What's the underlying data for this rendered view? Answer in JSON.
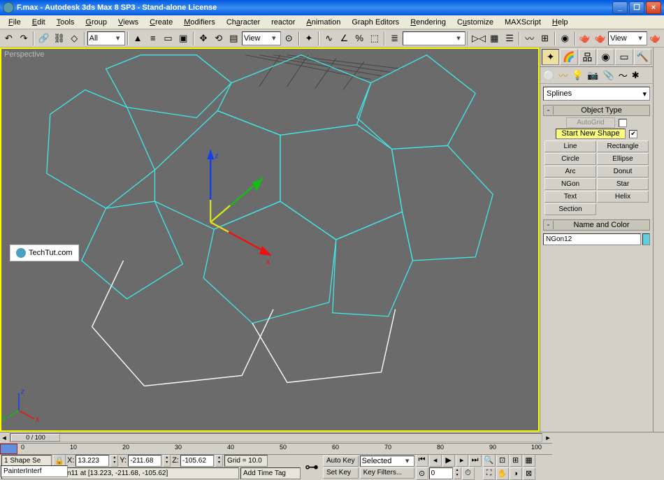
{
  "window": {
    "title": "F.max - Autodesk 3ds Max 8 SP3  - Stand-alone License"
  },
  "menus": [
    "File",
    "Edit",
    "Tools",
    "Group",
    "Views",
    "Create",
    "Modifiers",
    "Character",
    "reactor",
    "Animation",
    "Graph Editors",
    "Rendering",
    "Customize",
    "MAXScript",
    "Help"
  ],
  "toolbar": {
    "selection_set": "All",
    "view_label": "View",
    "view_label2": "View"
  },
  "viewport": {
    "label": "Perspective",
    "watermark": "TechTut.com",
    "axis_corner": {
      "x": "x",
      "y": "y",
      "z": "z"
    },
    "gizmo": {
      "x": "x",
      "y": "y",
      "z": "z"
    }
  },
  "create_panel": {
    "category": "Splines",
    "rollout_object_type": "Object Type",
    "autogrid": "AutoGrid",
    "start_new_shape": "Start New Shape",
    "buttons": {
      "line": "Line",
      "rectangle": "Rectangle",
      "circle": "Circle",
      "ellipse": "Ellipse",
      "arc": "Arc",
      "donut": "Donut",
      "ngon": "NGon",
      "star": "Star",
      "text": "Text",
      "helix": "Helix",
      "section": "Section"
    },
    "rollout_name": "Name and Color",
    "object_name": "NGon12"
  },
  "timeline": {
    "slider_label": "0 / 100",
    "ticks": [
      0,
      10,
      20,
      30,
      40,
      50,
      60,
      70,
      80,
      90,
      100
    ]
  },
  "status": {
    "macro_name": "PainterInterf",
    "selection": "1 Shape Se",
    "x_label": "X:",
    "x": "13.223",
    "y_label": "Y:",
    "y": "-211.68",
    "z_label": "Z:",
    "z": "-105.62",
    "grid": "Grid = 10.0",
    "snap_msg": "Vertex snap on NGon11 at [13.223, -211.68, -105.62]",
    "add_time_tag": "Add Time Tag",
    "auto_key": "Auto Key",
    "set_key": "Set Key",
    "selected": "Selected",
    "key_filters": "Key Filters..."
  }
}
